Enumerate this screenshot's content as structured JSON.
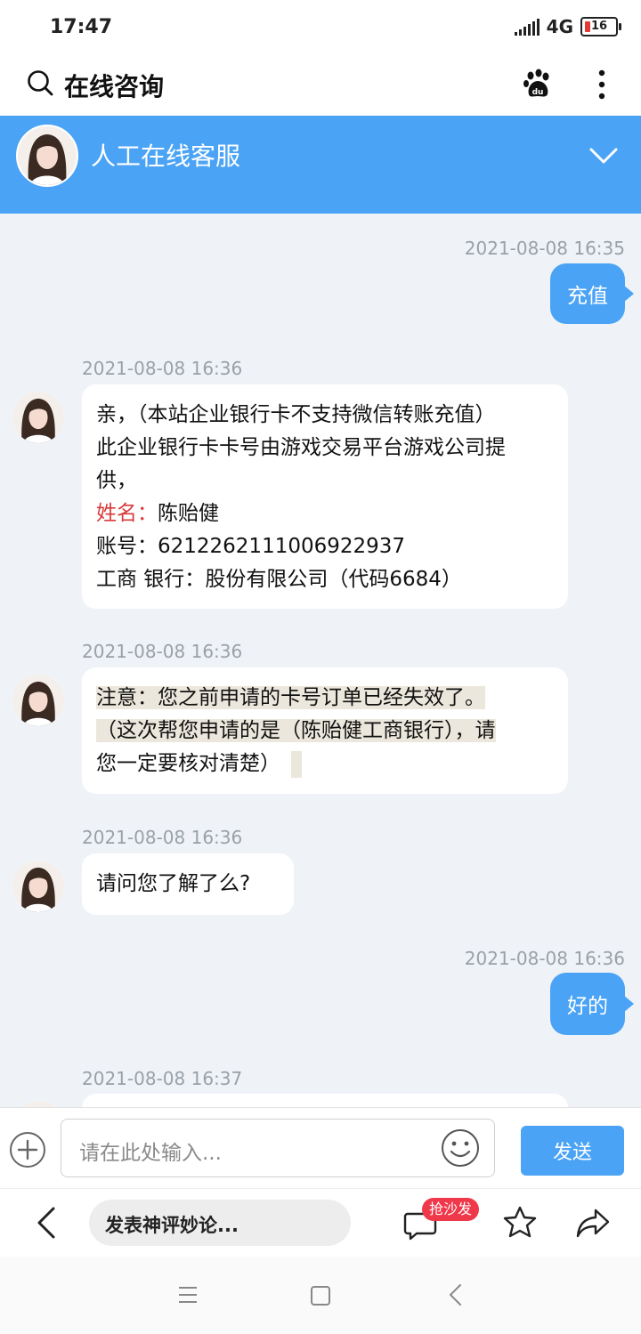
{
  "status_bar": {
    "time": "17:47",
    "network": "4G",
    "battery": "16"
  },
  "search_header": {
    "title": "在线咨询"
  },
  "chat_header": {
    "title": "人工在线客服"
  },
  "messages": [
    {
      "timestamp": "2021-08-08 16:35",
      "side": "out",
      "text": "充值"
    },
    {
      "timestamp": "2021-08-08 16:36",
      "side": "in",
      "line1": "亲，（本站企业银行卡不支持微信转账充值）",
      "line2": "此企业银行卡卡号由游戏交易平台游戏公司提",
      "line3": "供，",
      "name_label": "姓名：",
      "name_value": "陈贻健",
      "account_label": "账号：",
      "account_value": "6212262111006922937",
      "bank_label": "工商 银行：",
      "bank_value": "股份有限公司（代码6684）"
    },
    {
      "timestamp": "2021-08-08 16:36",
      "side": "in",
      "line1": "注意：您之前申请的卡号订单已经失效了。",
      "line2": "（这次帮您申请的是（陈贻健工商银行），请",
      "line3": "您一定要核对清楚）"
    },
    {
      "timestamp": "2021-08-08 16:36",
      "side": "in",
      "text": "请问您了解了么?"
    },
    {
      "timestamp": "2021-08-08 16:36",
      "side": "out",
      "text": "好的"
    },
    {
      "timestamp": "2021-08-08 16:37",
      "side": "in"
    }
  ],
  "input_bar": {
    "placeholder": "请在此处输入...",
    "send_label": "发送"
  },
  "comment_bar": {
    "placeholder": "发表神评妙论...",
    "badge": "抢沙发"
  },
  "colors": {
    "accent": "#4aa3f5",
    "chat_bg": "#eff3f8",
    "label_red": "#d93a3a",
    "badge_red": "#f0384b"
  }
}
